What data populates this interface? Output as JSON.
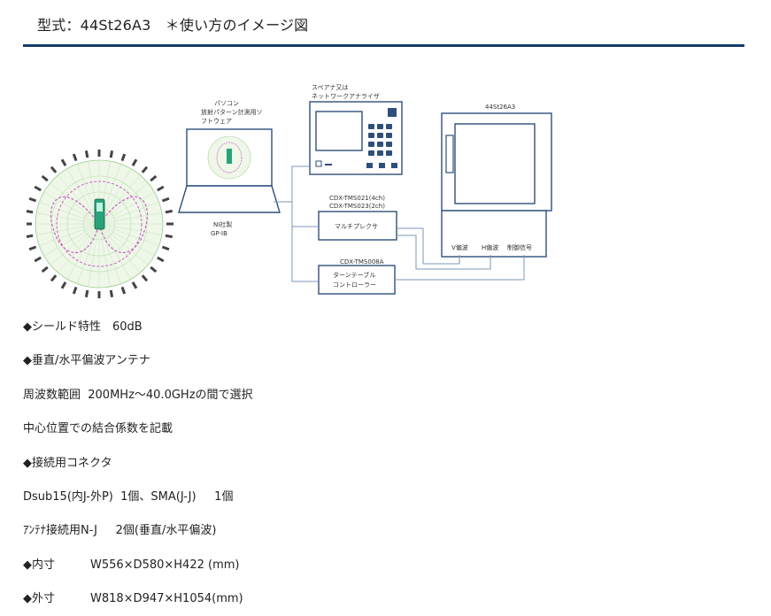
{
  "heading": "型式：44St26A3　＊使い方のイメージ図",
  "diagram": {
    "pc_label_1": "パソコン",
    "pc_label_2": "放射パターン計測用ソ",
    "pc_label_3": "フトウェア",
    "ni_label_1": "NI社製",
    "ni_label_2": "GP-IB",
    "spa_label_1": "スペアナ又は",
    "spa_label_2": "ネットワークアナライザ",
    "mux_model_1": "CDX-TMS021(4ch)",
    "mux_model_2": "CDX-TMS023(2ch)",
    "mux_name": "マルチプレクサ",
    "tt_model": "CDX-TMS008A",
    "tt_name_1": "ターンテーブル",
    "tt_name_2": "コントローラー",
    "chamber_model": "44St26A3",
    "port_v": "V偏波",
    "port_h": "H偏波",
    "port_ctrl": "制御信号"
  },
  "specs": [
    {
      "text": "◆シールド特性　60dB"
    },
    {
      "text": "◆垂直/水平偏波アンテナ"
    },
    {
      "text": "周波数範囲  200MHz～40.0GHzの間で選択"
    },
    {
      "text": "中心位置での結合係数を記載"
    },
    {
      "text": "◆接続用コネクタ"
    },
    {
      "text": "Dsub15(内J-外P)  1個、SMA(J-J)     1個"
    },
    {
      "text": "ｱﾝﾃﾅ接続用N-J     2個(垂直/水平偏波)"
    }
  ],
  "dims": [
    {
      "label": "◆内寸",
      "value": "W556×D580×H422 (mm)"
    },
    {
      "label": "◆外寸",
      "value": "W818×D947×H1054(mm)"
    }
  ]
}
